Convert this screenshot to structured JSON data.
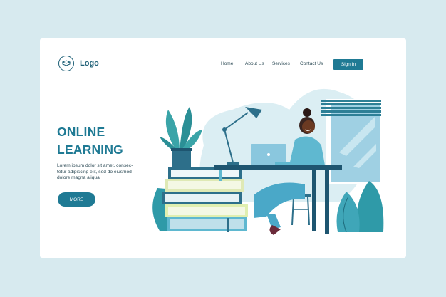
{
  "header": {
    "logo_label": "Logo",
    "logo_icon": "book-icon",
    "nav": [
      {
        "label": "Home"
      },
      {
        "label": "About Us"
      },
      {
        "label": "Services"
      },
      {
        "label": "Contact Us"
      }
    ],
    "signin_label": "Sign In"
  },
  "hero": {
    "title_lines": [
      "ONLINE",
      "LEARNING"
    ],
    "body_lines": [
      "Lorem ipsum dolor sit amet, consec-",
      "tetur adipiscing elit, sed do eiusmod",
      "dolore magna aliqua"
    ],
    "more_label": "MORE"
  },
  "colors": {
    "background": "#d7eaef",
    "accent": "#1f7a94",
    "dark_text": "#2c4a55"
  }
}
